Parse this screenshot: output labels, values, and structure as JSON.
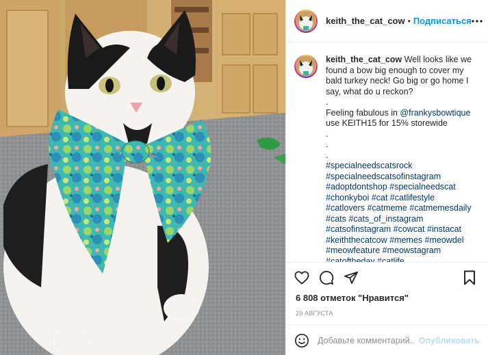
{
  "header": {
    "username": "keith_the_cat_cow",
    "separator": "•",
    "follow_label": "Подписаться",
    "more_icon": "more-horizontal-icon"
  },
  "caption": {
    "username": "keith_the_cat_cow",
    "lines": [
      {
        "text": "Well looks like we found a bow big enough to cover my bald turkey neck! Go big or go home I say, what do u reckon?",
        "type": "text"
      },
      {
        "text": ".",
        "type": "text"
      },
      {
        "text": "Feeling fabulous in ",
        "type": "text",
        "mention": "@frankysbowtique",
        "after": ""
      },
      {
        "text": "use KEITH15 for 15% storewide",
        "type": "text"
      },
      {
        "text": ".",
        "type": "text"
      },
      {
        "text": ".",
        "type": "text"
      },
      {
        "text": ".",
        "type": "text"
      }
    ],
    "hashtag_lines": [
      "#specialneedscatsrock",
      "#specialneedscatsofinstagram",
      "#adoptdontshop #specialneedscat",
      "#chonkyboi #cat #catlifestyle",
      "#catlovers #catmeme #catmemesdaily",
      "#cats #cats_of_instagram",
      "#catsofinstagram #cowcat #instacat",
      "#keiththecatcow #memes #meowdel",
      "#meowfeature #meowstagram",
      "#catoftheday #catlife"
    ]
  },
  "actions": {
    "like_icon": "heart-icon",
    "comment_icon": "comment-icon",
    "share_icon": "share-icon",
    "save_icon": "bookmark-icon"
  },
  "likes_text": "6 808 отметок \"Нравится\"",
  "date_text": "29 АВГУСТА",
  "comment_box": {
    "placeholder": "Добавьте комментарий...",
    "publish_label": "Опубликовать",
    "emoji_icon": "emoji-icon"
  },
  "colors": {
    "link_blue": "#0095f6",
    "hashtag": "#00376b",
    "publish_disabled": "#b2dffc",
    "bow_teal": "#2aa6a0"
  }
}
